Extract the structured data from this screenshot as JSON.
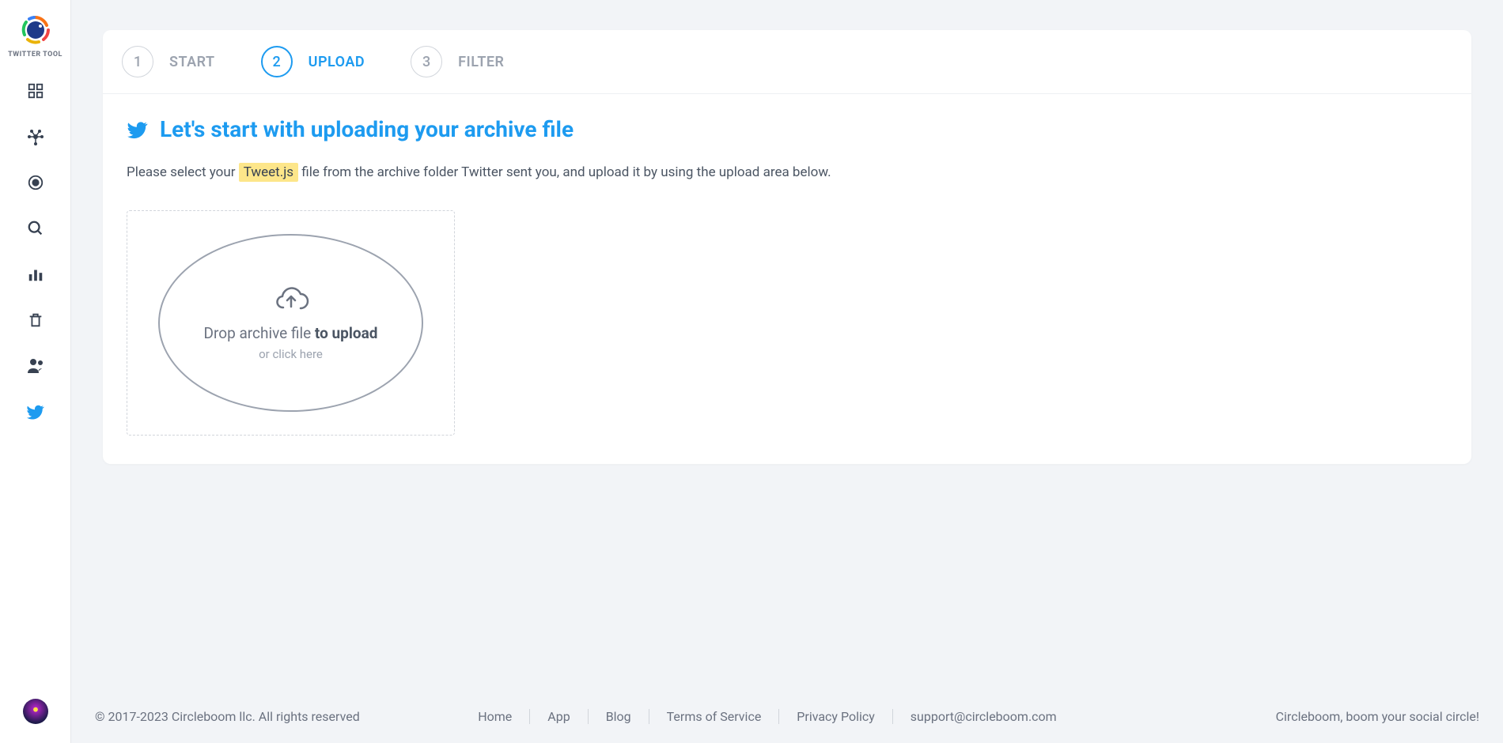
{
  "sidebar": {
    "logoText": "TWITTER TOOL"
  },
  "steps": [
    {
      "num": "1",
      "label": "START"
    },
    {
      "num": "2",
      "label": "UPLOAD"
    },
    {
      "num": "3",
      "label": "FILTER"
    }
  ],
  "panel": {
    "title": "Let's start with uploading your archive file",
    "instructionPre": "Please select your ",
    "instructionHighlight": "Tweet.js",
    "instructionPost": " file from the archive folder Twitter sent you, and upload it by using the upload area below.",
    "dropLinePre": "Drop archive file ",
    "dropLineBold": "to upload",
    "dropSub": "or click here"
  },
  "footer": {
    "copyright": "© 2017-2023 Circleboom llc. All rights reserved",
    "links": [
      "Home",
      "App",
      "Blog",
      "Terms of Service",
      "Privacy Policy",
      "support@circleboom.com"
    ],
    "tagline": "Circleboom, boom your social circle!"
  }
}
